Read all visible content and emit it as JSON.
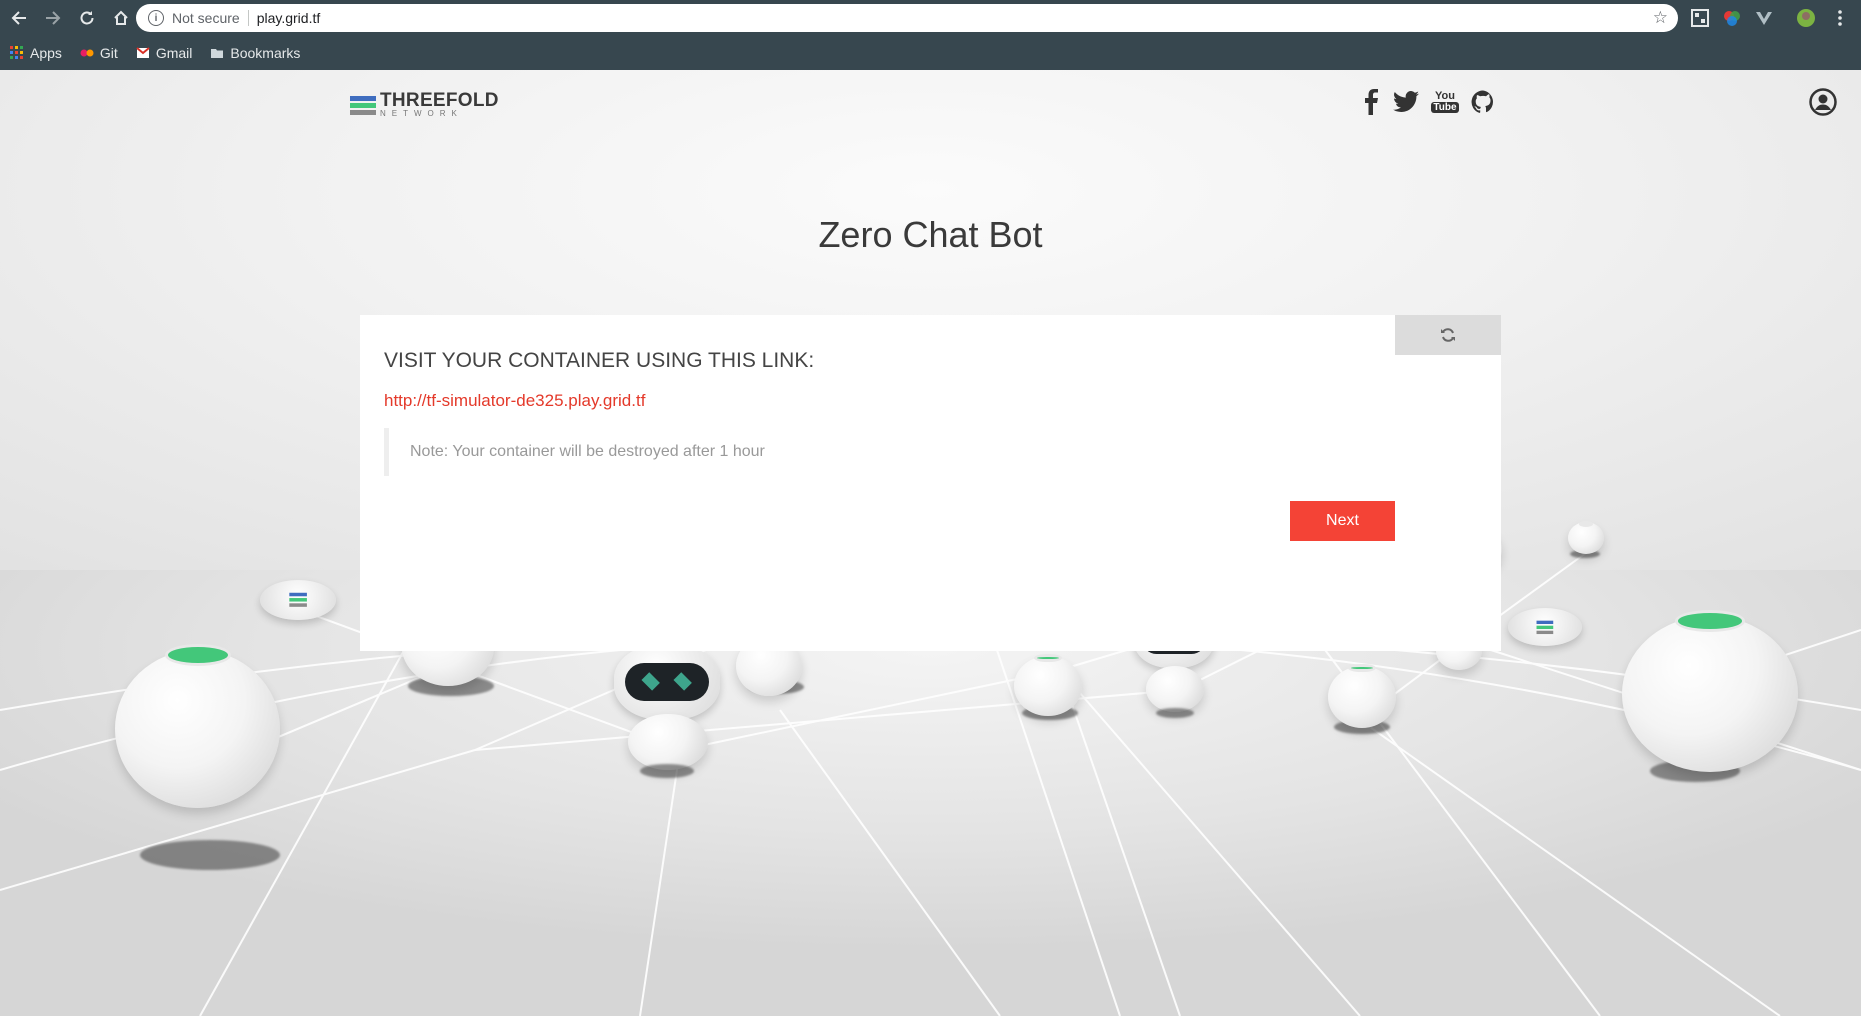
{
  "browser": {
    "address_security": "Not secure",
    "address_url": "play.grid.tf",
    "bookmarks": [
      {
        "label": "Apps",
        "icon": "apps-grid-icon"
      },
      {
        "label": "Git",
        "icon": "git-icon"
      },
      {
        "label": "Gmail",
        "icon": "gmail-icon"
      },
      {
        "label": "Bookmarks",
        "icon": "folder-icon"
      }
    ]
  },
  "header": {
    "logo_word": "THREEFOLD",
    "logo_sub": "NETWORK",
    "social_icons": [
      "facebook-icon",
      "twitter-icon",
      "youtube-icon",
      "github-icon"
    ],
    "youtube_text_top": "You",
    "youtube_text_bottom": "Tube"
  },
  "main": {
    "title": "Zero Chat Bot",
    "heading": "VISIT YOUR CONTAINER USING THIS LINK:",
    "link": "http://tf-simulator-de325.play.grid.tf",
    "note": "Note: Your container will be destroyed after 1 hour",
    "next_label": "Next",
    "refresh_icon": "refresh-icon"
  },
  "colors": {
    "chrome": "#37474f",
    "accent": "#f44336",
    "link": "#e4392a",
    "node_green": "#43c77a"
  }
}
